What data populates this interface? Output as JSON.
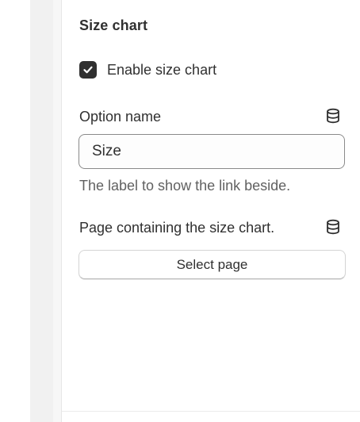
{
  "section": {
    "title": "Size chart"
  },
  "enable_size_chart": {
    "label": "Enable size chart",
    "checked": true
  },
  "option_name": {
    "label": "Option name",
    "value": "Size",
    "help": "The label to show the link beside.",
    "dynamic_source_icon": "database-icon"
  },
  "size_chart_page": {
    "label": "Page containing the size chart.",
    "button_label": "Select page",
    "dynamic_source_icon": "database-icon"
  },
  "colors": {
    "text": "#303030",
    "subdued_text": "#616161",
    "checkbox_fill": "#303030",
    "input_border": "#8a8a8a"
  }
}
